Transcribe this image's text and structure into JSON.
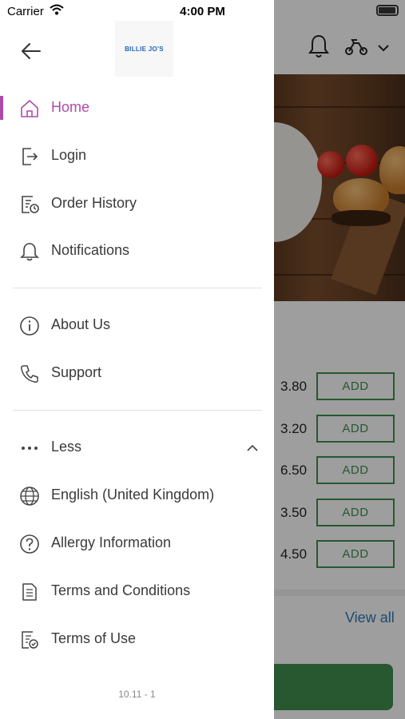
{
  "status_bar": {
    "carrier": "Carrier",
    "time": "4:00 PM"
  },
  "brand": {
    "logo_text": "BILLIE JO'S",
    "accent": "#b04aa8",
    "primary_green": "#3f8f4e"
  },
  "menu": {
    "primary": [
      {
        "label": "Home",
        "icon": "home-icon",
        "active": true
      },
      {
        "label": "Login",
        "icon": "login-icon"
      },
      {
        "label": "Order History",
        "icon": "order-history-icon"
      },
      {
        "label": "Notifications",
        "icon": "bell-icon"
      }
    ],
    "secondary": [
      {
        "label": "About Us",
        "icon": "info-icon"
      },
      {
        "label": "Support",
        "icon": "phone-icon"
      }
    ],
    "more_toggle": {
      "label": "Less",
      "icon": "more-dots-icon",
      "expanded": true
    },
    "extra": [
      {
        "label": "English (United Kingdom)",
        "icon": "globe-icon"
      },
      {
        "label": "Allergy Information",
        "icon": "question-icon"
      },
      {
        "label": "Terms and Conditions",
        "icon": "document-icon"
      },
      {
        "label": "Terms of Use",
        "icon": "document-check-icon"
      }
    ]
  },
  "version": "10.11 - 1",
  "background": {
    "prices": [
      "3.80",
      "3.20",
      "6.50",
      "3.50",
      "4.50"
    ],
    "add_label": "ADD",
    "view_all": "View all"
  }
}
